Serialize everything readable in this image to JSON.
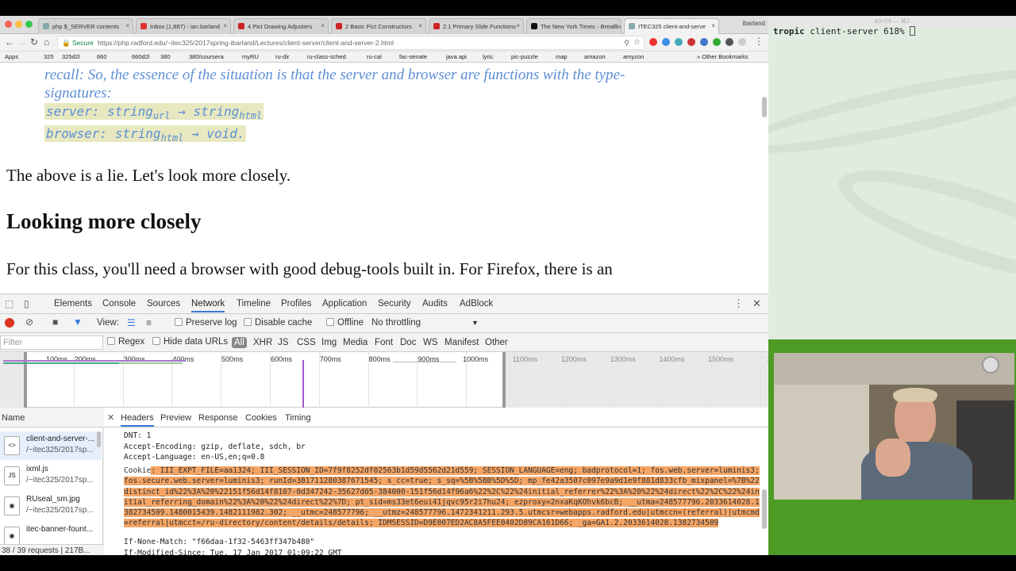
{
  "browser": {
    "tabs": [
      {
        "label": "php $_SERVER contents",
        "icon": "doc-icon"
      },
      {
        "label": "Inbox (1,887) - ian.barland",
        "icon": "gmail-icon"
      },
      {
        "label": "4 Pict Drawing Adjusters",
        "icon": "racket-icon"
      },
      {
        "label": "2 Basic Pict Constructors",
        "icon": "racket-icon"
      },
      {
        "label": "2.1 Primary Slide Functions",
        "icon": "racket-icon"
      },
      {
        "label": "The New York Times - Breaking",
        "icon": "nyt-icon"
      },
      {
        "label": "ITEC325 client-and-serve",
        "icon": "doc-icon"
      }
    ],
    "profile": "ibarland",
    "secure_label": "Secure",
    "url": "https://php.radford.edu/~itec325/2017spring-ibarland/Lectures/client-server/client-and-server-2.html",
    "bookmarks": [
      "Apps",
      "325",
      "325d2l",
      "660",
      "660d2l",
      "380",
      "380/coursera",
      "myRU",
      "ru-dir",
      "ru-class-sched",
      "ru-cal",
      "fac-senate",
      "java api",
      "lyric",
      "pic-puzzle",
      "map",
      "amazon",
      "amyzon"
    ],
    "other_bookmarks": "Other Bookmarks"
  },
  "page": {
    "recall_line1": "recall: So, the essence of the situation is that the server and browser are functions with the type-",
    "recall_line2": "signatures:",
    "server_sig": {
      "prefix": "server: string",
      "sub1": "url",
      "arrow": " → string",
      "sub2": "html"
    },
    "browser_sig": {
      "prefix": "browser: string",
      "sub1": "html",
      "arrow": " → void",
      "suffix": "."
    },
    "lie_text": "The above is a lie. Let's look more closely.",
    "heading": "Looking more closely",
    "para": "For this class, you'll need a browser with good debug-tools built in. For Firefox, there is an"
  },
  "devtools": {
    "tabs": [
      "Elements",
      "Console",
      "Sources",
      "Network",
      "Timeline",
      "Profiles",
      "Application",
      "Security",
      "Audits",
      "AdBlock"
    ],
    "active_tab": "Network",
    "view_label": "View:",
    "preserve_log": "Preserve log",
    "disable_cache": "Disable cache",
    "offline": "Offline",
    "throttle": "No throttling",
    "filter_placeholder": "Filter",
    "regex": "Regex",
    "hide_data_urls": "Hide data URLs",
    "types": [
      "All",
      "XHR",
      "JS",
      "CSS",
      "Img",
      "Media",
      "Font",
      "Doc",
      "WS",
      "Manifest",
      "Other"
    ],
    "ticks": [
      "100ms",
      "200ms",
      "300ms",
      "400ms",
      "500ms",
      "600ms",
      "700ms",
      "800ms",
      "900ms",
      "1000ms",
      "1100ms",
      "1200ms",
      "1300ms",
      "1400ms",
      "1500ms",
      "1600"
    ],
    "name_header": "Name",
    "requests": [
      {
        "name": "client-and-server-...",
        "path": "/~itec325/2017sp...",
        "icon": "html-file-icon"
      },
      {
        "name": "ixml.js",
        "path": "/~itec325/2017sp...",
        "icon": "js-file-icon"
      },
      {
        "name": "RUseal_sm.jpg",
        "path": "/~itec325/2017sp...",
        "icon": "image-file-icon"
      },
      {
        "name": "itec-banner-fount...",
        "path": "",
        "icon": "image-file-icon"
      }
    ],
    "summary": "38 / 39 requests | 217B...",
    "header_tabs": [
      "Headers",
      "Preview",
      "Response",
      "Cookies",
      "Timing"
    ],
    "active_header_tab": "Headers",
    "header_lines": [
      "DNT: 1",
      "Accept-Encoding: gzip, deflate, sdch, br",
      "Accept-Language: en-US,en;q=0.8"
    ],
    "cookie_label": "Cookie",
    "cookie_value": ": III_EXPT_FILE=aa1324; III_SESSION_ID=7f9f8252df02563b1d59d5562d21d559; SESSION_LANGUAGE=eng; badprotocol=1; fos.web.server=luminis3; fos.secure.web.server=luminis3; runId=381711280387671545; s_cc=true; s_sq=%5B%5BB%5D%5D; mp_fe42a3507c097e9a9d1e9f881d833cfb_mixpanel=%7B%22distinct_id%22%3A%20%22151f56d14f8107-0d347242-35627d05-384000-151f56d14f96a6%22%2C%22%24initial_referrer%22%3A%20%22%24direct%22%2C%22%24initial_referring_domain%22%3A%20%22%24direct%22%7D; pt_sid=ms33et6eui41jqvc95r2i7hu24; ezproxy=2nxaKqKOhvk6bcB; __utma=248577796.2033614028.1382734509.1480015439.1482111982.302; __utmc=248577796; __utmz=248577796.1472341211.293.5.utmcsr=webapps.radford.edu|utmccn=(referral)|utmcmd=referral|utmcct=/ru-directory/content/details/details; IDMSESSID=D9E007ED2AC8A5FEE0402D89CA161D66; _ga=GA1.2.2033614028.1382734509",
    "header_lines_after": [
      "If-None-Match: \"f66daa-1f32-5463ff347b480\"",
      "If-Modified-Since: Tue, 17 Jan 2017 01:09:22 GMT"
    ]
  },
  "terminal": {
    "title": "83×29 — ⌘2",
    "host": "tropic",
    "prompt_rest": " client-server 618% "
  },
  "colors": {
    "accent": "#3879d9",
    "recall": "#5b8ed6",
    "highlight": "#f5a565",
    "terminal_bg": "#e1ece1"
  }
}
